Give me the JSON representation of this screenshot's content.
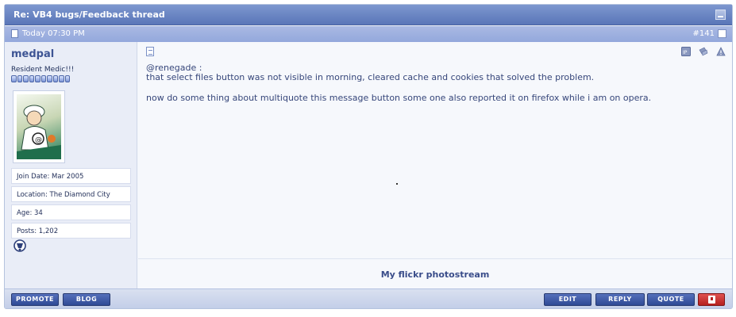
{
  "thread": {
    "title": "Re: VB4 bugs/Feedback thread"
  },
  "post": {
    "date": "Today 07:30 PM",
    "number": "#141",
    "message_lines": [
      "@renegade :",
      "that select files button was not visible in morning, cleared cache and cookies that solved the problem.",
      "",
      "now do some thing about multiquote this message button some one also reported it on firefox while i am on opera."
    ],
    "signature_link": "My flickr photostream"
  },
  "user": {
    "name": "medpal",
    "title": "Resident Medic!!!",
    "reputation_pips": 10,
    "join_date": "Join Date: Mar 2005",
    "location": "Location: The Diamond City",
    "age": "Age: 34",
    "posts": "Posts: 1,202"
  },
  "buttons": {
    "promote": "PROMOTE",
    "blog": "BLOG",
    "edit": "EDIT",
    "reply": "REPLY",
    "quote": "QUOTE"
  },
  "icons": {
    "title_collapse": "collapse-icon",
    "post_doc": "document-icon",
    "ip": "ip-icon",
    "infraction": "infraction-icon",
    "warning": "warning-icon",
    "report": "report-icon",
    "rank": "rank-icon"
  },
  "colors": {
    "title_bar": "#5a76b8",
    "date_bar": "#93a8dc",
    "button": "#2f4a95",
    "report_button": "#b5201f",
    "message_text": "#36467a"
  }
}
